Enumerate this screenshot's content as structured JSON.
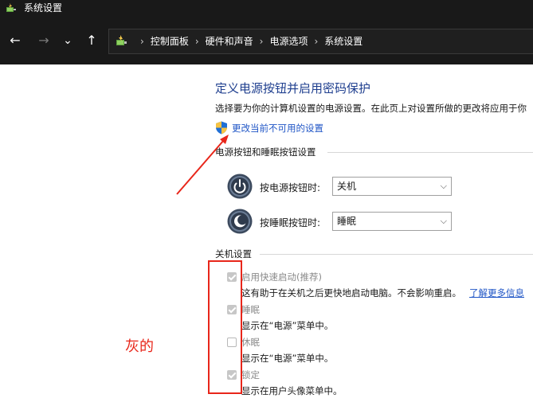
{
  "window": {
    "title": "系统设置"
  },
  "nav": {
    "back": "←",
    "forward": "→",
    "recent": "⌄",
    "up": "↑"
  },
  "breadcrumb": [
    "控制面板",
    "硬件和声音",
    "电源选项",
    "系统设置"
  ],
  "main": {
    "heading": "定义电源按钮并启用密码保护",
    "description": "选择要为你的计算机设置的电源设置。在此页上对设置所做的更改将应用于你",
    "change_link": "更改当前不可用的设置",
    "power_section": {
      "title": "电源按钮和睡眠按钮设置",
      "rows": [
        {
          "label": "按电源按钮时:",
          "value": "关机",
          "icon": "power-icon"
        },
        {
          "label": "按睡眠按钮时:",
          "value": "睡眠",
          "icon": "sleep-icon"
        }
      ]
    },
    "shutdown_section": {
      "title": "关机设置",
      "items": [
        {
          "label": "启用快速启动(推荐)",
          "checked": true,
          "desc": "这有助于在关机之后更快地启动电脑。不会影响重启。",
          "link": "了解更多信息"
        },
        {
          "label": "睡眠",
          "checked": true,
          "desc": "显示在“电源”菜单中。"
        },
        {
          "label": "休眠",
          "checked": false,
          "desc": "显示在“电源”菜单中。"
        },
        {
          "label": "锁定",
          "checked": true,
          "desc": "显示在用户头像菜单中。"
        }
      ]
    }
  },
  "annotation": {
    "text": "灰的",
    "color": "#e8261a"
  },
  "colors": {
    "heading": "#1f3f8f",
    "link": "#1f55c6",
    "titlebar": "#191919"
  }
}
